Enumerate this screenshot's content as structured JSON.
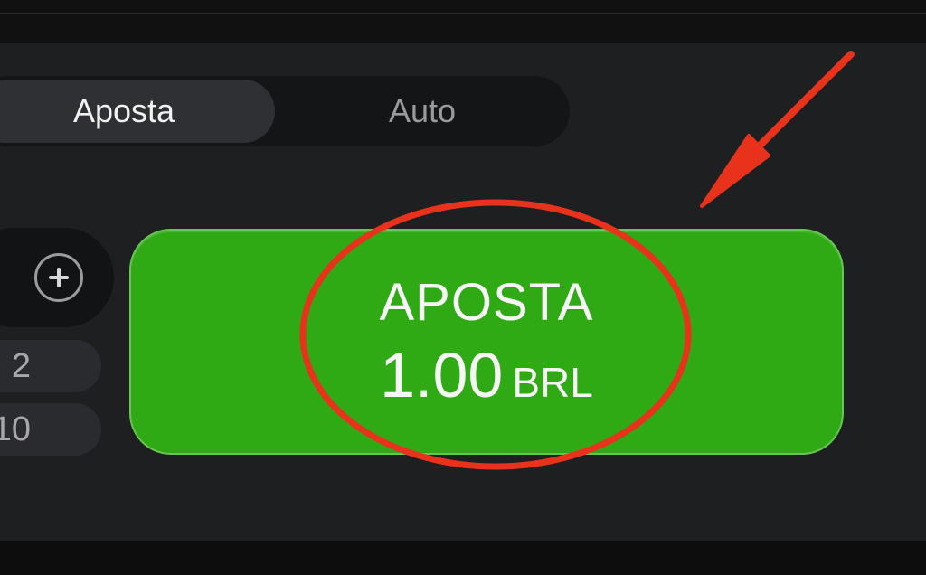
{
  "tabs": [
    {
      "label": "Aposta",
      "active": true
    },
    {
      "label": "Auto",
      "active": false
    }
  ],
  "stepper": {
    "increment_icon": "plus-circle-icon"
  },
  "quick_amounts": [
    "2",
    "10"
  ],
  "bet_button": {
    "title": "APOSTA",
    "amount": "1.00",
    "currency": "BRL"
  },
  "colors": {
    "bet_green": "#2fa914",
    "annotation_red": "#e8321c",
    "panel_bg": "#1e1f21"
  }
}
